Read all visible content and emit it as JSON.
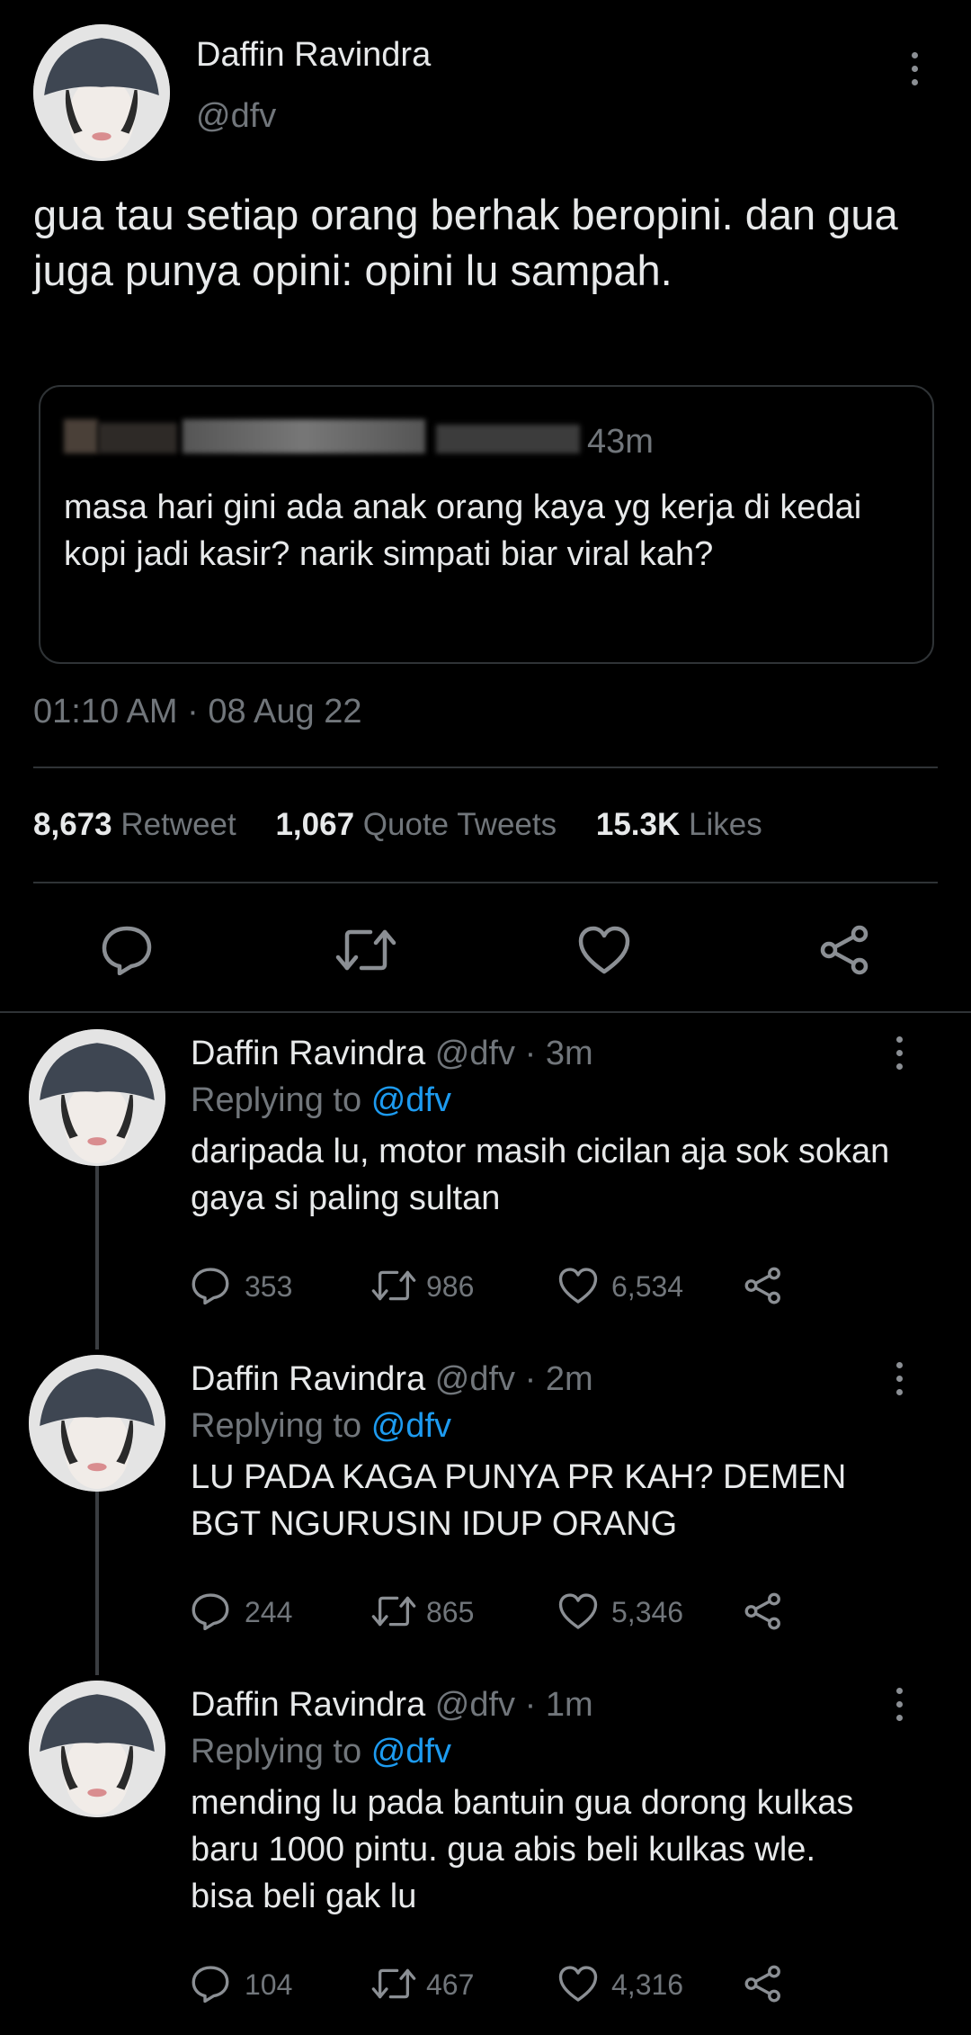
{
  "main_tweet": {
    "author_name": "Daffin Ravindra",
    "handle": "@dfv",
    "text": "gua tau setiap orang berhak beropini. dan gua juga punya opini: opini lu sampah.",
    "quoted": {
      "time": "43m",
      "text": "masa hari gini ada anak orang kaya yg kerja di kedai kopi jadi kasir? narik simpati biar viral kah?"
    },
    "timestamp": "01:10 AM · 08 Aug 22",
    "stats": {
      "retweets_count": "8,673",
      "retweets_label": "Retweet",
      "quotes_count": "1,067",
      "quotes_label": "Quote Tweets",
      "likes_count": "15.3K",
      "likes_label": "Likes"
    }
  },
  "replies": [
    {
      "author_name": "Daffin Ravindra",
      "handle_time": "@dfv · 3m",
      "replying_prefix": "Replying to",
      "replying_handle": "@dfv",
      "text": "daripada lu, motor masih cicilan aja sok sokan gaya si paling sultan",
      "reply_count": "353",
      "retweet_count": "986",
      "like_count": "6,534"
    },
    {
      "author_name": "Daffin Ravindra",
      "handle_time": "@dfv · 2m",
      "replying_prefix": "Replying to",
      "replying_handle": "@dfv",
      "text": "LU PADA KAGA PUNYA PR KAH? DEMEN BGT NGURUSIN IDUP ORANG",
      "reply_count": "244",
      "retweet_count": "865",
      "like_count": "5,346"
    },
    {
      "author_name": "Daffin Ravindra",
      "handle_time": "@dfv · 1m",
      "replying_prefix": "Replying to",
      "replying_handle": "@dfv",
      "text": "mending lu pada bantuin gua dorong kulkas baru 1000 pintu. gua abis beli kulkas wle. bisa beli gak lu",
      "reply_count": "104",
      "retweet_count": "467",
      "like_count": "4,316"
    }
  ],
  "colors": {
    "background": "#000000",
    "text": "#e7e9ea",
    "muted": "#71767b",
    "link": "#1d9bf0",
    "border": "#2f3336"
  }
}
